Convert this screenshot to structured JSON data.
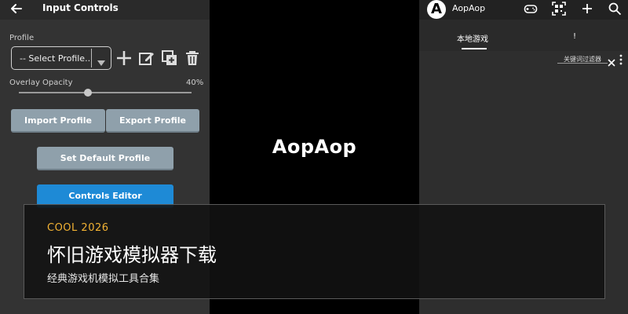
{
  "input_controls": {
    "title": "Input Controls",
    "profile_label": "Profile",
    "profile_selected": "-- Select Profile..",
    "overlay_opacity_label": "Overlay Opacity",
    "overlay_opacity_value": "40%",
    "overlay_opacity_fraction": 0.4,
    "import_button": "Import Profile",
    "export_button": "Export Profile",
    "set_default_button": "Set Default Profile",
    "controls_editor_button": "Controls Editor",
    "accent_color": "#1e8ad6",
    "button_color": "#8fa0ab"
  },
  "splash": {
    "logo_text": "AopAop"
  },
  "game_list": {
    "app_logo_letter": "A",
    "app_name": "AopAop",
    "tabs": [
      {
        "label": "本地游戏"
      },
      {
        "label": "!"
      }
    ],
    "filter_placeholder": "关键词过滤器",
    "icons": [
      "gamepad-icon",
      "qr-scan-icon",
      "add-icon",
      "search-icon",
      "close-icon",
      "more-vert-icon"
    ]
  },
  "overlay": {
    "tag": "COOL 2026",
    "title": "怀旧游戏模拟器下载",
    "subtitle": "经典游戏机模拟工具合集",
    "tag_color": "#f2b233"
  }
}
